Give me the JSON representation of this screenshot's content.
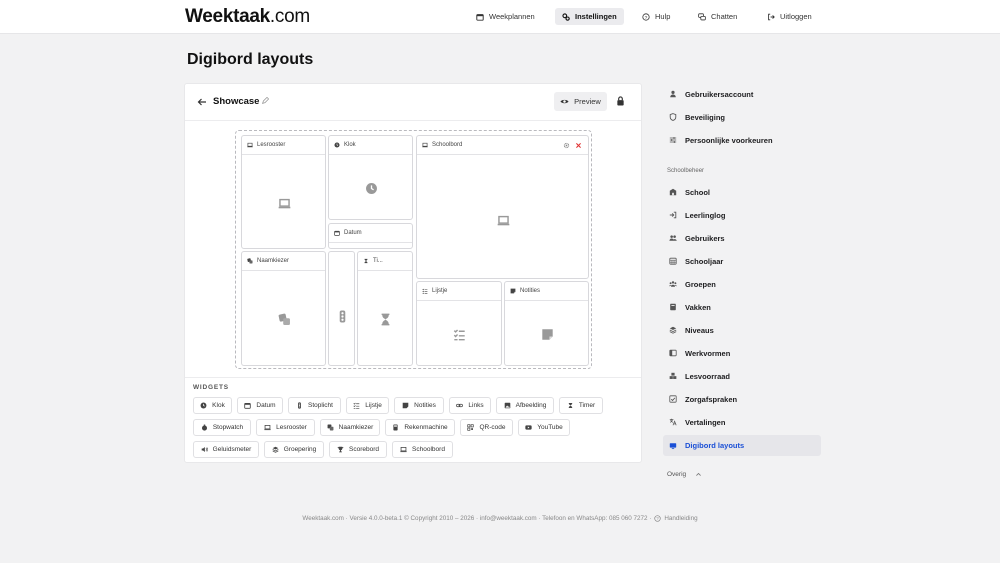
{
  "app": {
    "logo_bold": "Weektaak",
    "logo_light": ".com"
  },
  "nav": {
    "weekplannen": "Weekplannen",
    "instellingen": "Instellingen",
    "hulp": "Hulp",
    "chatten": "Chatten",
    "uitloggen": "Uitloggen"
  },
  "page": {
    "title": "Digibord layouts"
  },
  "editor": {
    "layout_name": "Showcase",
    "preview_label": "Preview",
    "widgets_label": "WIDGETS"
  },
  "canvas_widgets": [
    {
      "title": "Lesrooster",
      "icon": "laptop-icon"
    },
    {
      "title": "Klok",
      "icon": "clock-icon"
    },
    {
      "title": "Schoolbord",
      "icon": "laptop-icon"
    },
    {
      "title": "Datum",
      "icon": "calendar-icon"
    },
    {
      "title": "Naamkiezer",
      "icon": "dice-icon"
    },
    {
      "title": "Ti...",
      "icon": "hourglass-icon"
    },
    {
      "title": "Lijstje",
      "icon": "checklist-icon"
    },
    {
      "title": "Notities",
      "icon": "note-icon"
    }
  ],
  "widget_palette": [
    "Klok",
    "Datum",
    "Stoplicht",
    "Lijstje",
    "Notities",
    "Links",
    "Afbeelding",
    "Timer",
    "Stopwatch",
    "Lesrooster",
    "Naamkiezer",
    "Rekenmachine",
    "QR-code",
    "YouTube",
    "Geluidsmeter",
    "Groepering",
    "Scorebord",
    "Schoolbord"
  ],
  "sidebar": {
    "account_items": [
      "Gebruikersaccount",
      "Beveiliging",
      "Persoonlijke voorkeuren"
    ],
    "section_label": "Schoolbeheer",
    "school_items": [
      "School",
      "Leerlinglog",
      "Gebruikers",
      "Schooljaar",
      "Groepen",
      "Vakken",
      "Niveaus",
      "Werkvormen",
      "Lesvoorraad",
      "Zorgafspraken",
      "Vertalingen",
      "Digibord layouts"
    ],
    "active_item": "Digibord layouts",
    "overig_label": "Overig"
  },
  "footer": {
    "text": "Weektaak.com · Versie 4.0.0-beta.1 © Copyright 2010 – 2026 · info@weektaak.com · Telefoon en WhatsApp: 085 060 7272 ·",
    "manual_label": "Handleiding"
  },
  "colors": {
    "accent": "#1a4fd6",
    "danger": "#e03030",
    "background": "#f2f2f3"
  }
}
